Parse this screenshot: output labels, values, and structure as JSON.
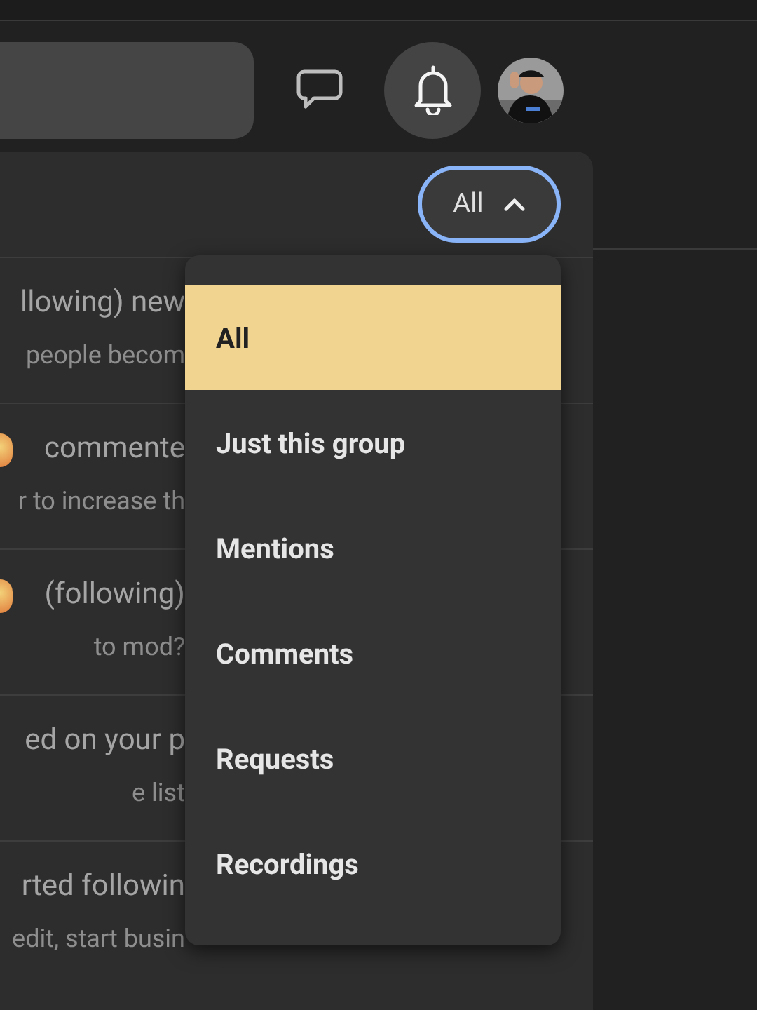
{
  "filter_button": {
    "label": "All",
    "expanded": true
  },
  "notifications": [
    {
      "title": "llowing) new",
      "snippet": "people becom",
      "kind": "plain"
    },
    {
      "title": "commente",
      "snippet": "r to increase th",
      "kind": "emoji"
    },
    {
      "title": "(following)",
      "snippet": "to mod?",
      "kind": "emoji"
    },
    {
      "title": "ed on your p",
      "snippet": "e list",
      "kind": "plain"
    },
    {
      "title": "rted followin",
      "snippet": "edit, start busin",
      "kind": "plain"
    }
  ],
  "filter_menu": [
    {
      "label": "All",
      "selected": true
    },
    {
      "label": "Just this group",
      "selected": false
    },
    {
      "label": "Mentions",
      "selected": false
    },
    {
      "label": "Comments",
      "selected": false
    },
    {
      "label": "Requests",
      "selected": false
    },
    {
      "label": "Recordings",
      "selected": false
    }
  ]
}
